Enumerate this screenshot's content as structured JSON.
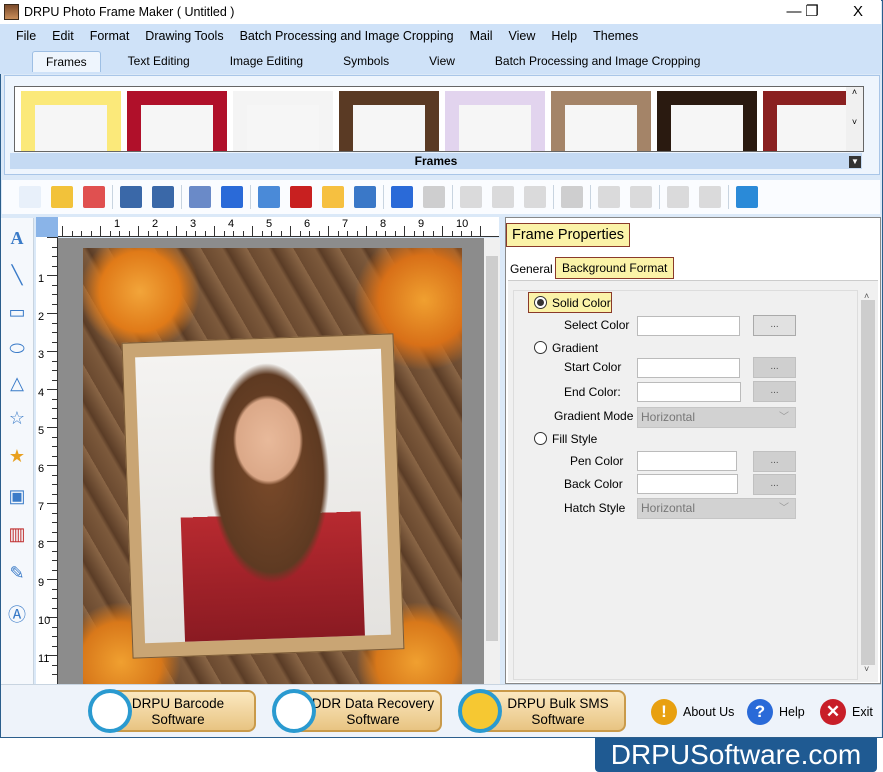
{
  "window": {
    "title": "DRPU Photo Frame Maker ( Untitled )",
    "minimize": "—",
    "restore": "❐",
    "close": "X"
  },
  "menu": [
    "File",
    "Edit",
    "Format",
    "Drawing Tools",
    "Batch Processing and Image Cropping",
    "Mail",
    "View",
    "Help",
    "Themes"
  ],
  "ribbon_tabs": [
    {
      "label": "Frames",
      "active": true
    },
    {
      "label": "Text Editing"
    },
    {
      "label": "Image Editing"
    },
    {
      "label": "Symbols"
    },
    {
      "label": "View"
    },
    {
      "label": "Batch Processing and Image Cropping"
    }
  ],
  "gallery": {
    "caption": "Frames",
    "thumb_colors": [
      "#fbe97a",
      "#b0102a",
      "#f4f4f4",
      "#5a3a24",
      "#e2d4ee",
      "#a48468",
      "#2a1a10",
      "#8a2020"
    ]
  },
  "toolbar_icons": [
    "new-icon",
    "open-icon",
    "close-file-icon",
    "save-icon",
    "save-as-icon",
    "page-setup-icon",
    "frame-icon",
    "export-image-icon",
    "export-pdf-icon",
    "mail-icon",
    "print-icon",
    "undo-icon",
    "redo-icon",
    "cut-icon",
    "copy-icon",
    "paste-icon",
    "delete-icon",
    "bring-front-icon",
    "send-back-icon",
    "lock-icon",
    "unlock-icon",
    "fit-icon"
  ],
  "ruler": {
    "h": [
      "1",
      "2",
      "3",
      "4",
      "5",
      "6",
      "7",
      "8",
      "9",
      "10"
    ],
    "v": [
      "1",
      "2",
      "3",
      "4",
      "5",
      "6",
      "7",
      "8",
      "9",
      "10",
      "11"
    ]
  },
  "properties": {
    "title": "Frame Properties",
    "tabs": [
      "General",
      "Background Format"
    ],
    "solid_color": "Solid Color",
    "select_color": "Select Color",
    "gradient": "Gradient",
    "start_color": "Start Color",
    "end_color": "End Color:",
    "gradient_mode": "Gradient Mode",
    "gradient_mode_value": "Horizontal",
    "fill_style": "Fill Style",
    "pen_color": "Pen Color",
    "back_color": "Back Color",
    "hatch_style": "Hatch Style",
    "hatch_style_value": "Horizontal",
    "browse": "...",
    "selected": "Solid Color"
  },
  "bottom": {
    "promos": [
      {
        "l1": "DRPU Barcode",
        "l2": "Software"
      },
      {
        "l1": "DDR Data Recovery",
        "l2": "Software"
      },
      {
        "l1": "DRPU Bulk SMS",
        "l2": "Software"
      }
    ],
    "about": "About Us",
    "help": "Help",
    "exit": "Exit"
  },
  "watermark": "DRPUSoftware.com"
}
